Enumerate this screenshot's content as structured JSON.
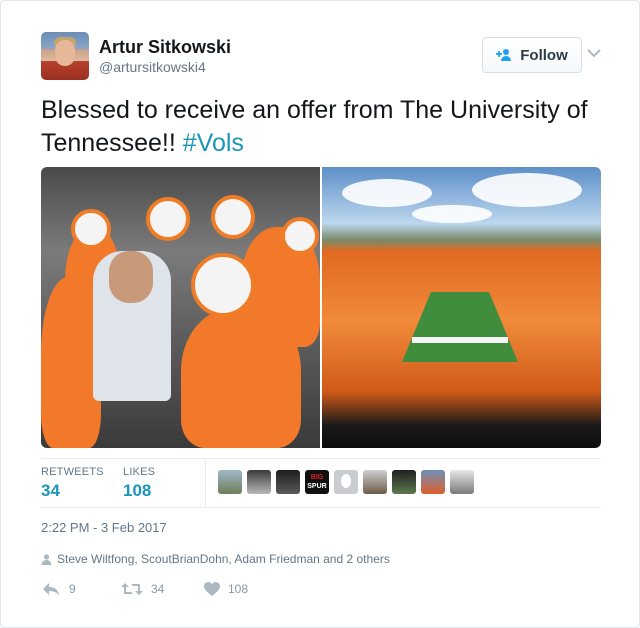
{
  "author": {
    "name": "Artur Sitkowski",
    "handle": "@artursitkowski4",
    "follow_label": "Follow"
  },
  "tweet": {
    "text": "Blessed to receive an offer from The University of Tennessee!! ",
    "hashtag": "#Vols"
  },
  "stats": {
    "retweets_label": "RETWEETS",
    "retweets_count": "34",
    "likes_label": "LIKES",
    "likes_count": "108"
  },
  "likers": {
    "spur_badge_line1": "BIG",
    "spur_badge_line2": "SPUR"
  },
  "timestamp": "2:22 PM - 3 Feb 2017",
  "social_context": "Steve Wiltfong, ScoutBrianDohn, Adam Friedman and 2 others",
  "actions": {
    "reply_count": "9",
    "retweet_count": "34",
    "like_count": "108"
  },
  "colors": {
    "link": "#1b95b9",
    "secondary_text": "#657786",
    "tennessee_orange": "#f2782a"
  },
  "icons": {
    "follow": "user-plus-icon",
    "menu": "chevron-down-icon",
    "social_context": "person-icon",
    "reply": "reply-icon",
    "retweet": "retweet-icon",
    "like": "heart-icon"
  }
}
